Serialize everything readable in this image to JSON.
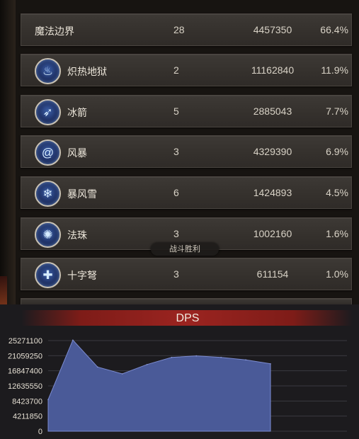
{
  "skills": [
    {
      "name": "魔法边界",
      "count": "28",
      "damage": "4457350",
      "percent": "66.4%",
      "icon": null
    },
    {
      "name": "炽热地狱",
      "count": "2",
      "damage": "11162840",
      "percent": "11.9%",
      "icon": "flame-icon"
    },
    {
      "name": "冰箭",
      "count": "5",
      "damage": "2885043",
      "percent": "7.7%",
      "icon": "ice-arrow-icon"
    },
    {
      "name": "风暴",
      "count": "3",
      "damage": "4329390",
      "percent": "6.9%",
      "icon": "storm-icon"
    },
    {
      "name": "暴风雪",
      "count": "6",
      "damage": "1424893",
      "percent": "4.5%",
      "icon": "blizzard-icon"
    },
    {
      "name": "法珠",
      "count": "3",
      "damage": "1002160",
      "percent": "1.6%",
      "icon": "orb-icon"
    },
    {
      "name": "十字弩",
      "count": "3",
      "damage": "611154",
      "percent": "1.0%",
      "icon": "crossbow-icon"
    }
  ],
  "badge": "战斗胜利",
  "dps": {
    "title": "DPS"
  },
  "chart_data": {
    "type": "area",
    "title": "DPS",
    "xlabel": "",
    "ylabel": "",
    "ylim": [
      0,
      25271100
    ],
    "yticks": [
      "25271100",
      "21059250",
      "16847400",
      "12635550",
      "8423700",
      "4211850",
      "0"
    ],
    "x": [
      0,
      1,
      2,
      3,
      4,
      5,
      6,
      7,
      8,
      9
    ],
    "values": [
      8800000,
      25400000,
      17900000,
      16000000,
      18600000,
      20600000,
      21000000,
      20600000,
      19900000,
      18800000
    ],
    "grid": true,
    "color": "#4a5a98"
  }
}
